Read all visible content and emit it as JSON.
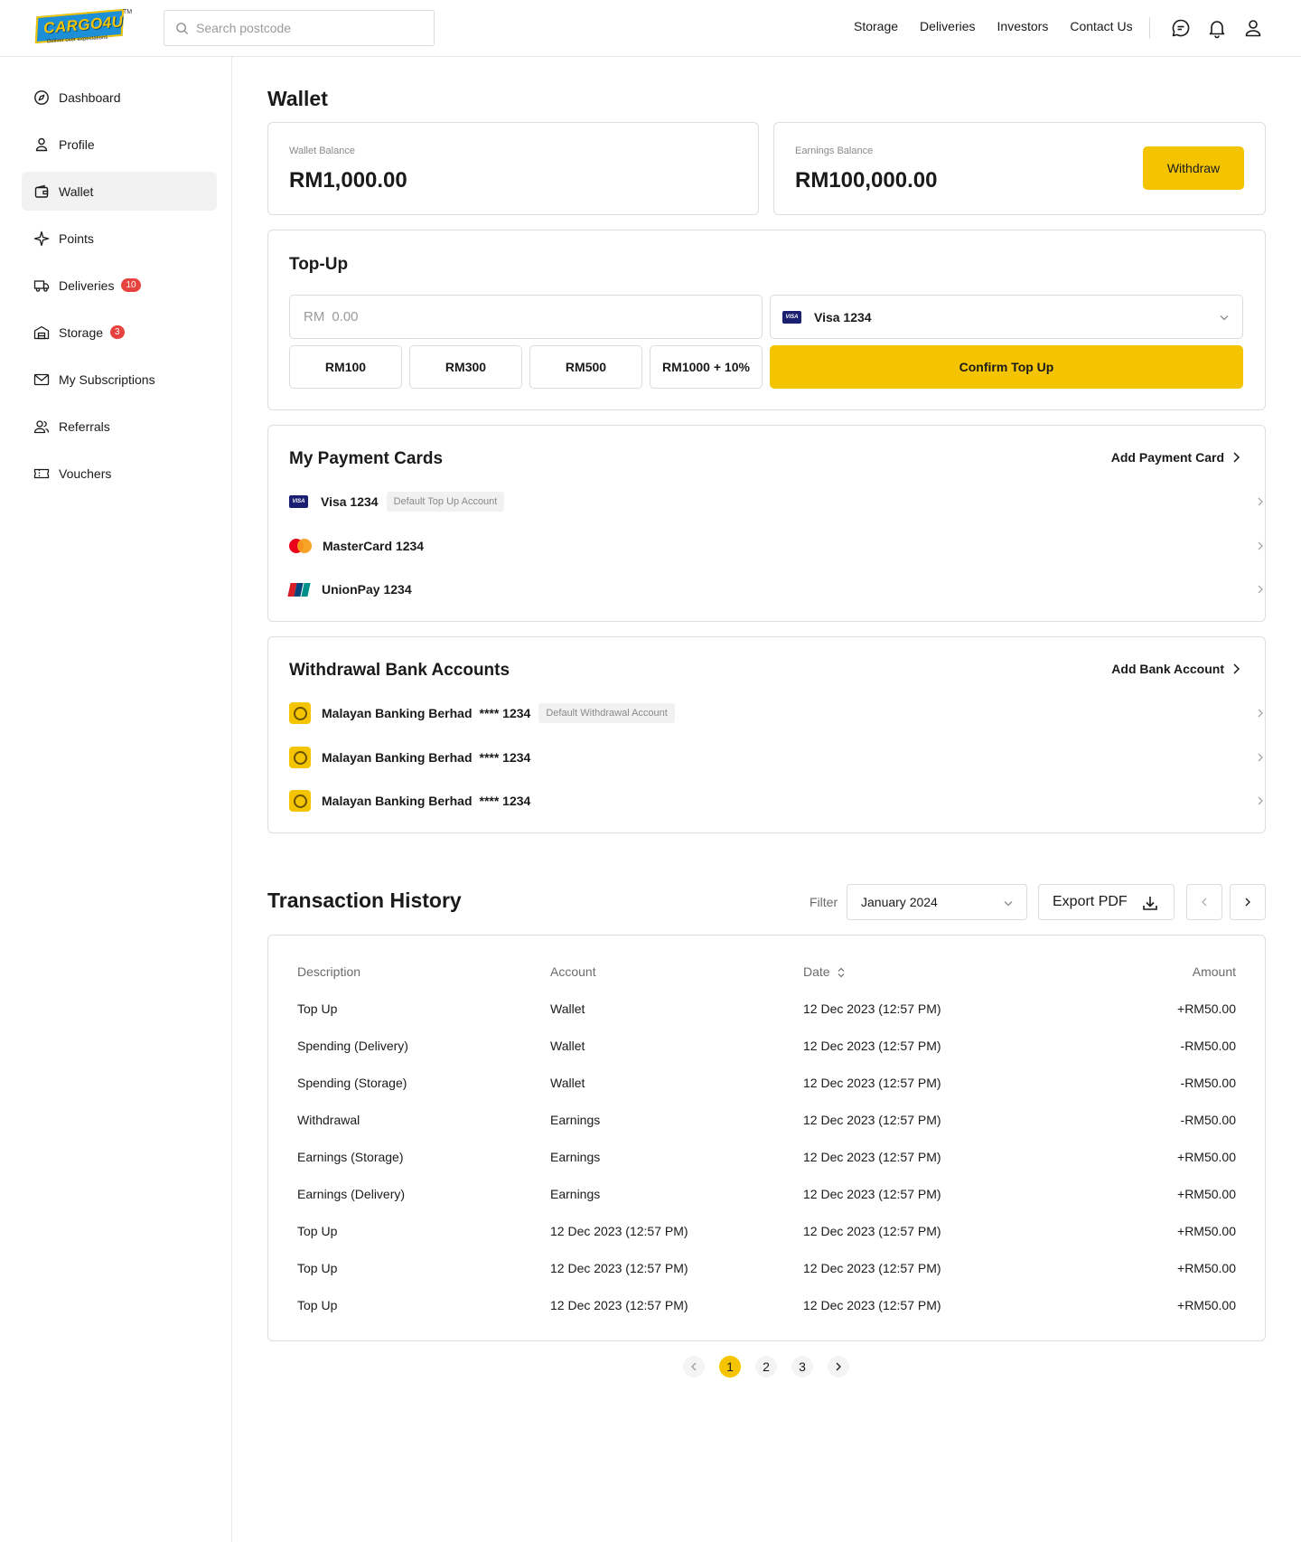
{
  "brand": {
    "logo_text": "CARGO4U",
    "tagline": "Deliver over expectations",
    "trademark": "TM",
    "accent_color": "#f4c400"
  },
  "header": {
    "search_placeholder": "Search postcode",
    "nav": [
      "Storage",
      "Deliveries",
      "Investors",
      "Contact Us"
    ],
    "icons": [
      "chat-icon",
      "bell-icon",
      "user-icon"
    ]
  },
  "sidebar": {
    "items": [
      {
        "label": "Dashboard",
        "icon": "compass-icon"
      },
      {
        "label": "Profile",
        "icon": "user-icon"
      },
      {
        "label": "Wallet",
        "icon": "wallet-icon",
        "active": true
      },
      {
        "label": "Points",
        "icon": "sparkle-icon"
      },
      {
        "label": "Deliveries",
        "icon": "truck-icon",
        "badge": "10"
      },
      {
        "label": "Storage",
        "icon": "warehouse-icon",
        "badge": "3"
      },
      {
        "label": "My Subscriptions",
        "icon": "mail-icon"
      },
      {
        "label": "Referrals",
        "icon": "users-icon"
      },
      {
        "label": "Vouchers",
        "icon": "ticket-icon"
      }
    ]
  },
  "page": {
    "title": "Wallet"
  },
  "wallet": {
    "wallet_label": "Wallet Balance",
    "wallet_value": "RM1,000.00",
    "earnings_label": "Earnings Balance",
    "earnings_value": "RM100,000.00",
    "withdraw_label": "Withdraw"
  },
  "topup": {
    "title": "Top-Up",
    "currency_prefix": "RM",
    "amount_placeholder": "0.00",
    "selected_card": "Visa 1234",
    "presets": [
      "RM100",
      "RM300",
      "RM500",
      "RM1000 + 10%"
    ],
    "confirm_label": "Confirm Top Up"
  },
  "payment_cards": {
    "title": "My Payment Cards",
    "add_label": "Add Payment Card",
    "default_tag": "Default Top Up Account",
    "items": [
      {
        "name": "Visa 1234",
        "brand": "visa"
      },
      {
        "name": "MasterCard 1234",
        "brand": "mastercard"
      },
      {
        "name": "UnionPay 1234",
        "brand": "unionpay"
      }
    ]
  },
  "bank_accounts": {
    "title": "Withdrawal Bank Accounts",
    "add_label": "Add Bank Account",
    "default_tag": "Default Withdrawal Account",
    "items": [
      {
        "bank": "Malayan Banking Berhad",
        "number": "**** 1234"
      },
      {
        "bank": "Malayan Banking Berhad",
        "number": "**** 1234"
      },
      {
        "bank": "Malayan Banking Berhad",
        "number": "**** 1234"
      }
    ]
  },
  "transactions": {
    "title": "Transaction History",
    "filter_label": "Filter",
    "filter_value": "January 2024",
    "export_label": "Export PDF",
    "columns": [
      "Description",
      "Account",
      "Date",
      "Amount"
    ],
    "rows": [
      [
        "Top Up",
        "Wallet",
        "12 Dec 2023 (12:57 PM)",
        "+RM50.00"
      ],
      [
        "Spending (Delivery)",
        "Wallet",
        "12 Dec 2023 (12:57 PM)",
        "-RM50.00"
      ],
      [
        "Spending (Storage)",
        "Wallet",
        "12 Dec 2023 (12:57 PM)",
        "-RM50.00"
      ],
      [
        "Withdrawal",
        "Earnings",
        "12 Dec 2023 (12:57 PM)",
        "-RM50.00"
      ],
      [
        "Earnings (Storage)",
        "Earnings",
        "12 Dec 2023 (12:57 PM)",
        "+RM50.00"
      ],
      [
        "Earnings (Delivery)",
        "Earnings",
        "12 Dec 2023 (12:57 PM)",
        "+RM50.00"
      ],
      [
        "Top Up",
        "12 Dec 2023 (12:57 PM)",
        "12 Dec 2023 (12:57 PM)",
        "+RM50.00"
      ],
      [
        "Top Up",
        "12 Dec 2023 (12:57 PM)",
        "12 Dec 2023 (12:57 PM)",
        "+RM50.00"
      ],
      [
        "Top Up",
        "12 Dec 2023 (12:57 PM)",
        "12 Dec 2023 (12:57 PM)",
        "+RM50.00"
      ]
    ],
    "pages": [
      "1",
      "2",
      "3"
    ],
    "current_page": "1"
  }
}
